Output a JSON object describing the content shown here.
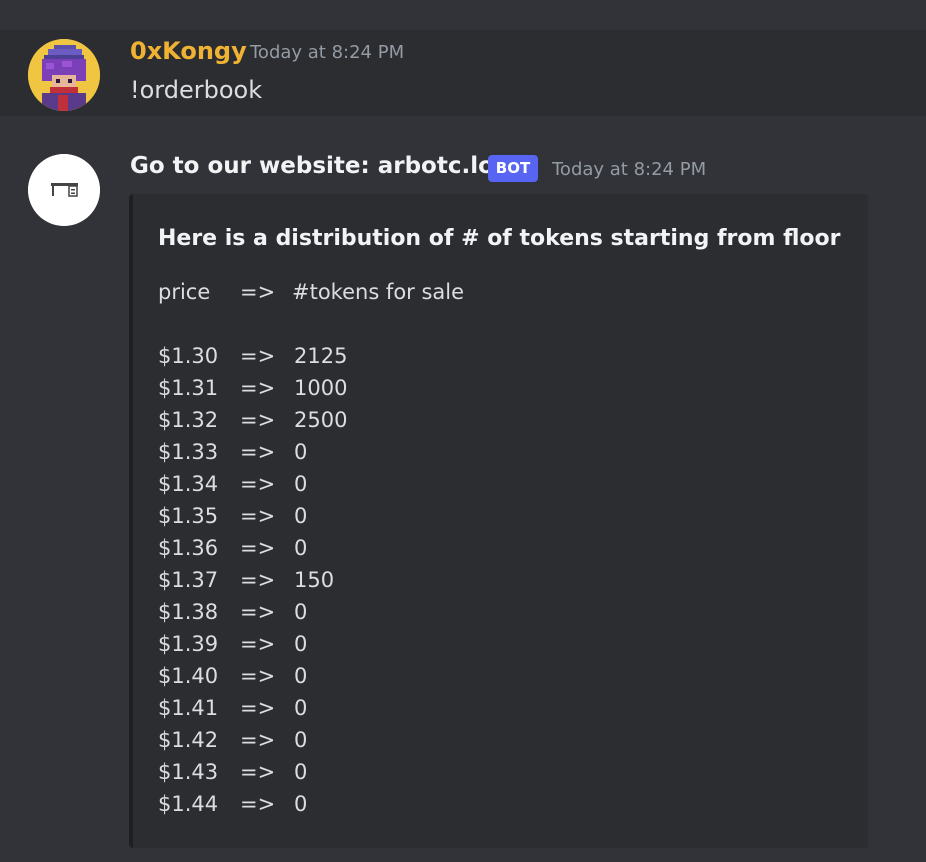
{
  "message1": {
    "username": "0xKongy",
    "timestamp": "Today at 8:24 PM",
    "content": "!orderbook",
    "avatar": "pixel-character-avatar"
  },
  "message2": {
    "username": "Go to our website: arbotc.lol",
    "badge": "BOT",
    "timestamp": "Today at 8:24 PM",
    "avatar": "desk-icon-avatar"
  },
  "embed": {
    "title": "Here is a distribution of # of tokens starting from floor",
    "header": {
      "price": "price",
      "arrow": "=>",
      "label": "#tokens for sale"
    },
    "rows": [
      {
        "price": "$1.30",
        "arrow": "=>",
        "count": "2125"
      },
      {
        "price": "$1.31",
        "arrow": "=>",
        "count": "1000"
      },
      {
        "price": "$1.32",
        "arrow": "=>",
        "count": "2500"
      },
      {
        "price": "$1.33",
        "arrow": "=>",
        "count": "0"
      },
      {
        "price": "$1.34",
        "arrow": "=>",
        "count": "0"
      },
      {
        "price": "$1.35",
        "arrow": "=>",
        "count": "0"
      },
      {
        "price": "$1.36",
        "arrow": "=>",
        "count": "0"
      },
      {
        "price": "$1.37",
        "arrow": "=>",
        "count": "150"
      },
      {
        "price": "$1.38",
        "arrow": "=>",
        "count": "0"
      },
      {
        "price": "$1.39",
        "arrow": "=>",
        "count": "0"
      },
      {
        "price": "$1.40",
        "arrow": "=>",
        "count": "0"
      },
      {
        "price": "$1.41",
        "arrow": "=>",
        "count": "0"
      },
      {
        "price": "$1.42",
        "arrow": "=>",
        "count": "0"
      },
      {
        "price": "$1.43",
        "arrow": "=>",
        "count": "0"
      },
      {
        "price": "$1.44",
        "arrow": "=>",
        "count": "0"
      }
    ]
  },
  "colors": {
    "background": "#313338",
    "highlighted_message": "#2b2d31",
    "username": "#f0b232",
    "bot_badge": "#5865f2",
    "timestamp": "#949ba4"
  }
}
